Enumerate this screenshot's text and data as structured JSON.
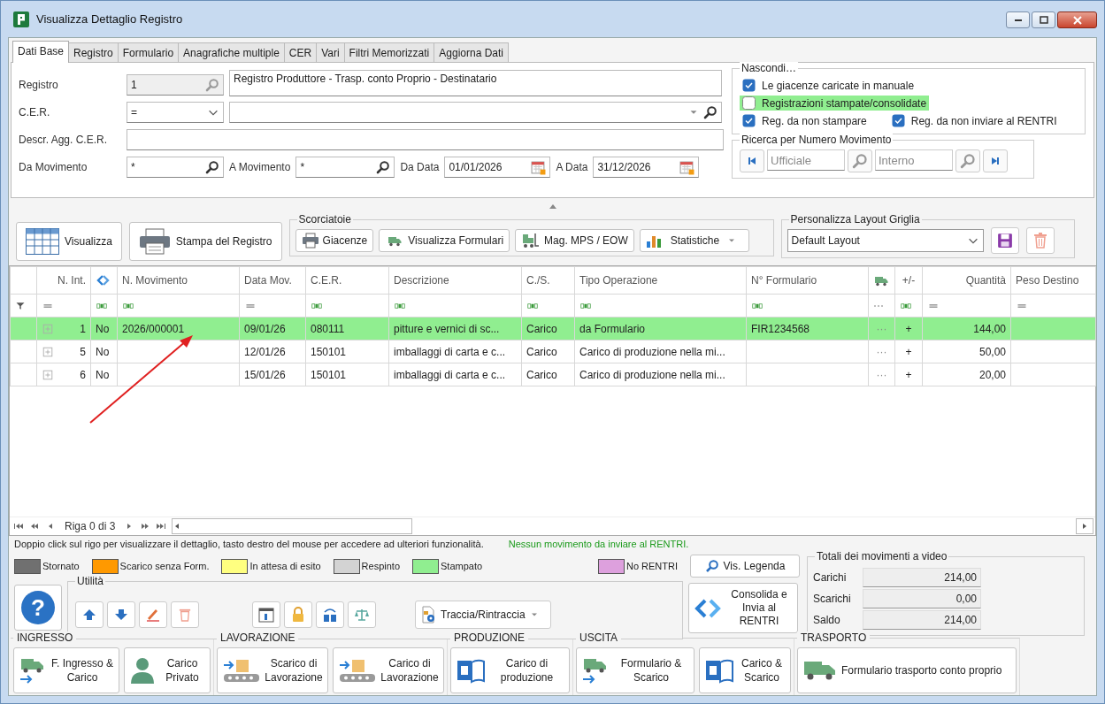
{
  "window": {
    "title": "Visualizza Dettaglio Registro"
  },
  "tabs": [
    {
      "label": "Dati Base",
      "selected": true
    },
    {
      "label": "Registro",
      "selected": false
    },
    {
      "label": "Formulario",
      "selected": false
    },
    {
      "label": "Anagrafiche multiple",
      "selected": false
    },
    {
      "label": "CER",
      "selected": false
    },
    {
      "label": "Vari",
      "selected": false
    },
    {
      "label": "Filtri Memorizzati",
      "selected": false
    },
    {
      "label": "Aggiorna Dati",
      "selected": false
    }
  ],
  "form": {
    "registro": {
      "label": "Registro",
      "code": "1",
      "description": "Registro Produttore - Trasp. conto Proprio - Destinatario"
    },
    "cer": {
      "label": "C.E.R.",
      "operator": "="
    },
    "descr_agg": {
      "label": "Descr. Agg. C.E.R."
    },
    "da_movimento": {
      "label": "Da Movimento",
      "value": "*"
    },
    "a_movimento": {
      "label": "A Movimento",
      "value": "*"
    },
    "da_data": {
      "label": "Da Data",
      "value": "01/01/2026"
    },
    "a_data": {
      "label": "A Data",
      "value": "31/12/2026"
    }
  },
  "nascondi": {
    "title": "Nascondi…",
    "options": [
      {
        "label": "Le giacenze caricate in manuale",
        "checked": true,
        "highlighted": false
      },
      {
        "label": "Registrazioni stampate/consolidate",
        "checked": false,
        "highlighted": true
      },
      {
        "label": "Reg. da non stampare",
        "checked": true,
        "highlighted": false
      },
      {
        "label": "Reg. da non inviare al RENTRI",
        "checked": true,
        "highlighted": false
      }
    ]
  },
  "ricerca": {
    "title": "Ricerca per Numero Movimento",
    "fields": [
      {
        "placeholder": "Ufficiale"
      },
      {
        "placeholder": "Interno"
      }
    ]
  },
  "toolbar": {
    "buttons": [
      {
        "label": "Visualizza"
      },
      {
        "label": "Stampa del Registro"
      }
    ]
  },
  "shortcuts": {
    "title": "Scorciatoie",
    "buttons": [
      {
        "label": "Giacenze"
      },
      {
        "label": "Visualizza Formulari"
      },
      {
        "label": "Mag. MPS / EOW"
      },
      {
        "label": "Statistiche"
      }
    ]
  },
  "layout": {
    "title": "Personalizza Layout Griglia",
    "value": "Default Layout"
  },
  "grid": {
    "columns": [
      {
        "kind": "indicator",
        "filter": {
          "kind": "funnel"
        }
      },
      {
        "kind": "text",
        "label": "N. Int.",
        "filter": {
          "kind": "equals"
        }
      },
      {
        "kind": "rentri",
        "filter": {
          "kind": "text"
        }
      },
      {
        "kind": "text",
        "label": "N. Movimento",
        "filter": {
          "kind": "text"
        }
      },
      {
        "kind": "text",
        "label": "Data Mov.",
        "filter": {
          "kind": "equals"
        }
      },
      {
        "kind": "text",
        "label": "C.E.R.",
        "filter": {
          "kind": "text"
        }
      },
      {
        "kind": "text",
        "label": "Descrizione",
        "filter": {
          "kind": "text"
        }
      },
      {
        "kind": "text",
        "label": "C./S.",
        "filter": {
          "kind": "text"
        }
      },
      {
        "kind": "text",
        "label": "Tipo Operazione",
        "filter": {
          "kind": "text"
        }
      },
      {
        "kind": "text",
        "label": "N° Formulario",
        "filter": {
          "kind": "text"
        }
      },
      {
        "kind": "truck",
        "filter": {
          "kind": "dots"
        }
      },
      {
        "kind": "text",
        "label": "+/-",
        "filter": {
          "kind": "text"
        }
      },
      {
        "kind": "text",
        "label": "Quantità",
        "filter": {
          "kind": "equals"
        }
      },
      {
        "kind": "text",
        "label": "Peso Destino",
        "filter": {
          "kind": "equals"
        }
      }
    ],
    "rows": [
      {
        "color": "#90ee90",
        "cells": [
          null,
          "1",
          "No",
          "2026/000001",
          "09/01/26",
          "080111",
          "pitture e vernici di sc...",
          "Carico",
          "da Formulario",
          "FIR1234568",
          "···",
          "+",
          "144,00",
          null
        ]
      },
      {
        "color": "#ffffff",
        "cells": [
          null,
          "5",
          "No",
          null,
          "12/01/26",
          "150101",
          "imballaggi di carta e c...",
          "Carico",
          "Carico di produzione nella mi...",
          null,
          "···",
          "+",
          "50,00",
          null
        ]
      },
      {
        "color": "#ffffff",
        "cells": [
          null,
          "6",
          "No",
          null,
          "15/01/26",
          "150101",
          "imballaggi di carta e c...",
          "Carico",
          "Carico di produzione nella mi...",
          null,
          "···",
          "+",
          "20,00",
          null
        ]
      }
    ]
  },
  "navigator": {
    "position": "Riga 0 di 3"
  },
  "hint": "Doppio click sul rigo per visualizzare il dettaglio, tasto destro del mouse per accedere ad ulteriori funzionalità.",
  "status_message": "Nessun movimento da inviare al RENTRI.",
  "legend": [
    {
      "label": "Stornato",
      "color": "#707070"
    },
    {
      "label": "Scarico senza Form.",
      "color": "#ff9900"
    },
    {
      "label": "In attesa di esito",
      "color": "#ffff80"
    },
    {
      "label": "Respinto",
      "color": "#d3d3d3"
    },
    {
      "label": "Stampato",
      "color": "#90ee90"
    },
    {
      "label": "No RENTRI",
      "color": "#dda0dd"
    }
  ],
  "legend_button": "Vis. Legenda",
  "help_button": "?",
  "utilita": {
    "title": "Utilità",
    "dropdown": "Traccia/Rintraccia"
  },
  "consolida_button": "Consolida e Invia al RENTRI",
  "totals": {
    "title": "Totali dei movimenti a video",
    "rows": [
      {
        "label": "Carichi",
        "value": "214,00"
      },
      {
        "label": "Scarichi",
        "value": "0,00"
      },
      {
        "label": "Saldo",
        "value": "214,00"
      }
    ]
  },
  "sections": [
    {
      "title": "INGRESSO",
      "buttons": [
        {
          "label": "F. Ingresso & Carico",
          "kind": "truckin"
        },
        {
          "label": "Carico Privato",
          "kind": "person"
        }
      ]
    },
    {
      "title": "LAVORAZIONE",
      "buttons": [
        {
          "label": "Scarico di Lavorazione",
          "kind": "conveyor"
        },
        {
          "label": "Carico di Lavorazione",
          "kind": "conveyor"
        }
      ]
    },
    {
      "title": "PRODUZIONE",
      "buttons": [
        {
          "label": "Carico di produzione",
          "kind": "book"
        }
      ]
    },
    {
      "title": "USCITA",
      "buttons": [
        {
          "label": "Formulario & Scarico",
          "kind": "truckin"
        },
        {
          "label": "Carico & Scarico",
          "kind": "book"
        }
      ]
    },
    {
      "title": "TRASPORTO",
      "buttons": [
        {
          "label": "Formulario trasporto conto proprio",
          "kind": "truck"
        }
      ]
    }
  ]
}
